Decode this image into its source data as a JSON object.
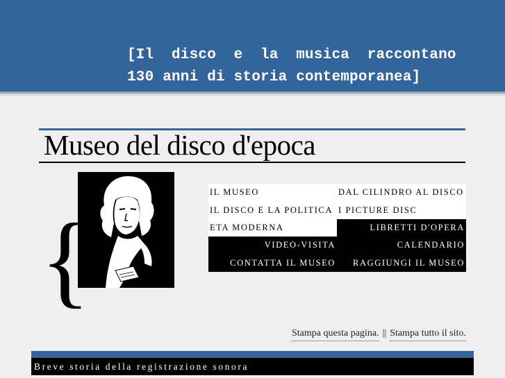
{
  "banner": {
    "tagline_line1": "[Il  disco  e  la  musica  raccontano",
    "tagline_line2": "130 anni di storia contemporanea]"
  },
  "page": {
    "title": "Museo del disco d'epoca"
  },
  "menu": {
    "items": [
      {
        "label": "IL MUSEO"
      },
      {
        "label": "DAL CILINDRO AL DISCO"
      },
      {
        "label": "IL DISCO E LA POLITICA"
      },
      {
        "label": "I PICTURE DISC"
      },
      {
        "label": "ETA MODERNA"
      },
      {
        "label": "LIBRETTI D'OPERA"
      },
      {
        "label": "VIDEO-VISITA"
      },
      {
        "label": "CALENDARIO"
      },
      {
        "label": "CONTATTA IL MUSEO"
      },
      {
        "label": "RAGGIUNGI IL MUSEO"
      }
    ]
  },
  "print": {
    "print_page": "Stampa questa pagina.",
    "separator": "||",
    "print_site": "Stampa tutto il sito."
  },
  "footer": {
    "heading": "Breve storia della registrazione sonora"
  },
  "colors": {
    "banner_blue": "#33659a",
    "background": "#efefef",
    "menu_dark": "#000000",
    "menu_light": "#ffffff"
  }
}
